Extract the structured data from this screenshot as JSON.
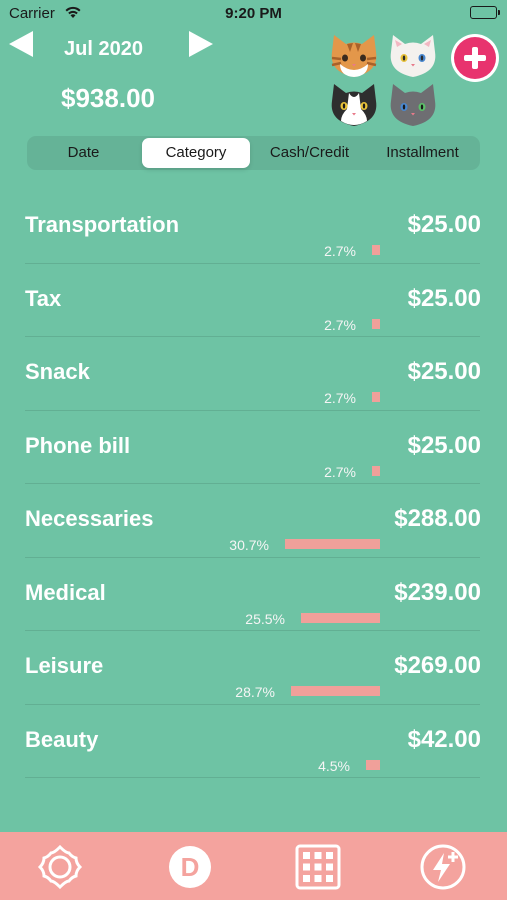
{
  "status": {
    "carrier": "Carrier",
    "time": "9:20 PM"
  },
  "header": {
    "month": "Jul 2020",
    "total": "$938.00"
  },
  "segments": [
    "Date",
    "Category",
    "Cash/Credit",
    "Installment"
  ],
  "selected_segment": "Category",
  "categories": [
    {
      "name": "Transportation",
      "amount": "$25.00",
      "percent": "2.7%",
      "share": 0.027
    },
    {
      "name": "Tax",
      "amount": "$25.00",
      "percent": "2.7%",
      "share": 0.027
    },
    {
      "name": "Snack",
      "amount": "$25.00",
      "percent": "2.7%",
      "share": 0.027
    },
    {
      "name": "Phone bill",
      "amount": "$25.00",
      "percent": "2.7%",
      "share": 0.027
    },
    {
      "name": "Necessaries",
      "amount": "$288.00",
      "percent": "30.7%",
      "share": 0.307
    },
    {
      "name": "Medical",
      "amount": "$239.00",
      "percent": "25.5%",
      "share": 0.255
    },
    {
      "name": "Leisure",
      "amount": "$269.00",
      "percent": "28.7%",
      "share": 0.287
    },
    {
      "name": "Beauty",
      "amount": "$42.00",
      "percent": "4.5%",
      "share": 0.045
    }
  ],
  "colors": {
    "background": "#6ec3a4",
    "tab_bar": "#f4a39e",
    "bar": "#f0a09a",
    "add_button": "#e8336e"
  },
  "icons": {
    "prev": "left-arrow-icon",
    "next": "right-arrow-icon",
    "add": "plus-circle-icon",
    "tabs": [
      "flower-icon",
      "d-badge-icon",
      "grid-icon",
      "lightning-plus-icon"
    ]
  },
  "tab_d_letter": "D"
}
